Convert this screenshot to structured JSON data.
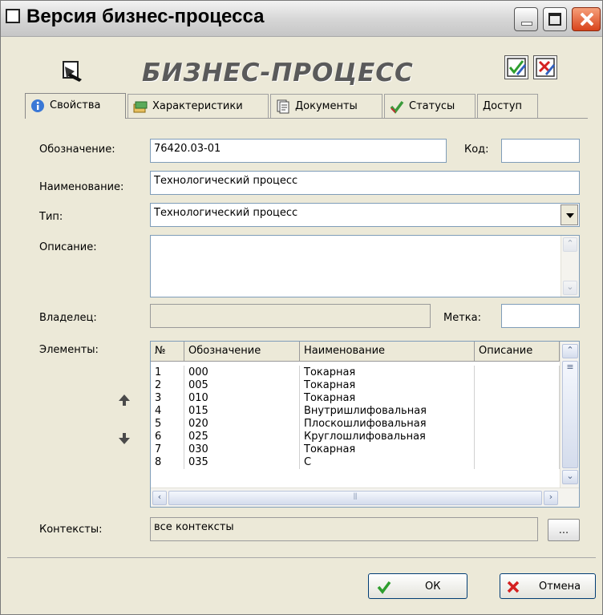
{
  "window": {
    "title": "Версия бизнес-процесса"
  },
  "header": {
    "title": "БИЗНЕС-ПРОЦЕСС"
  },
  "tabs": [
    {
      "label": "Свойства"
    },
    {
      "label": "Характеристики"
    },
    {
      "label": "Документы"
    },
    {
      "label": "Статусы"
    },
    {
      "label": "Доступ"
    }
  ],
  "form": {
    "designation_label": "Обозначение:",
    "designation_value": "76420.03-01",
    "code_label": "Код:",
    "code_value": "",
    "name_label": "Наименование:",
    "name_value": "Технологический процесс",
    "type_label": "Тип:",
    "type_value": "Технологический процесс",
    "description_label": "Описание:",
    "description_value": "",
    "owner_label": "Владелец:",
    "owner_value": "",
    "tag_label": "Метка:",
    "tag_value": "",
    "elements_label": "Элементы:",
    "contexts_label": "Контексты:",
    "contexts_value": "все контексты",
    "contexts_button": "..."
  },
  "elements_table": {
    "columns": [
      "№",
      "Обозначение",
      "Наименование",
      "Описание"
    ],
    "rows": [
      [
        "1",
        "000",
        "Токарная",
        ""
      ],
      [
        "2",
        "005",
        "Токарная",
        ""
      ],
      [
        "3",
        "010",
        "Токарная",
        ""
      ],
      [
        "4",
        "015",
        "Внутришлифовальная",
        ""
      ],
      [
        "5",
        "020",
        "Плоскошлифовальная",
        ""
      ],
      [
        "6",
        "025",
        "Круглошлифовальная",
        ""
      ],
      [
        "7",
        "030",
        "Токарная",
        ""
      ],
      [
        "8",
        "035",
        "С",
        ""
      ]
    ]
  },
  "buttons": {
    "ok": "ОК",
    "cancel": "Отмена"
  },
  "colors": {
    "ok_check": "#2e9e2e",
    "cancel_x": "#d42020",
    "status_check": "#3b9b3b"
  }
}
